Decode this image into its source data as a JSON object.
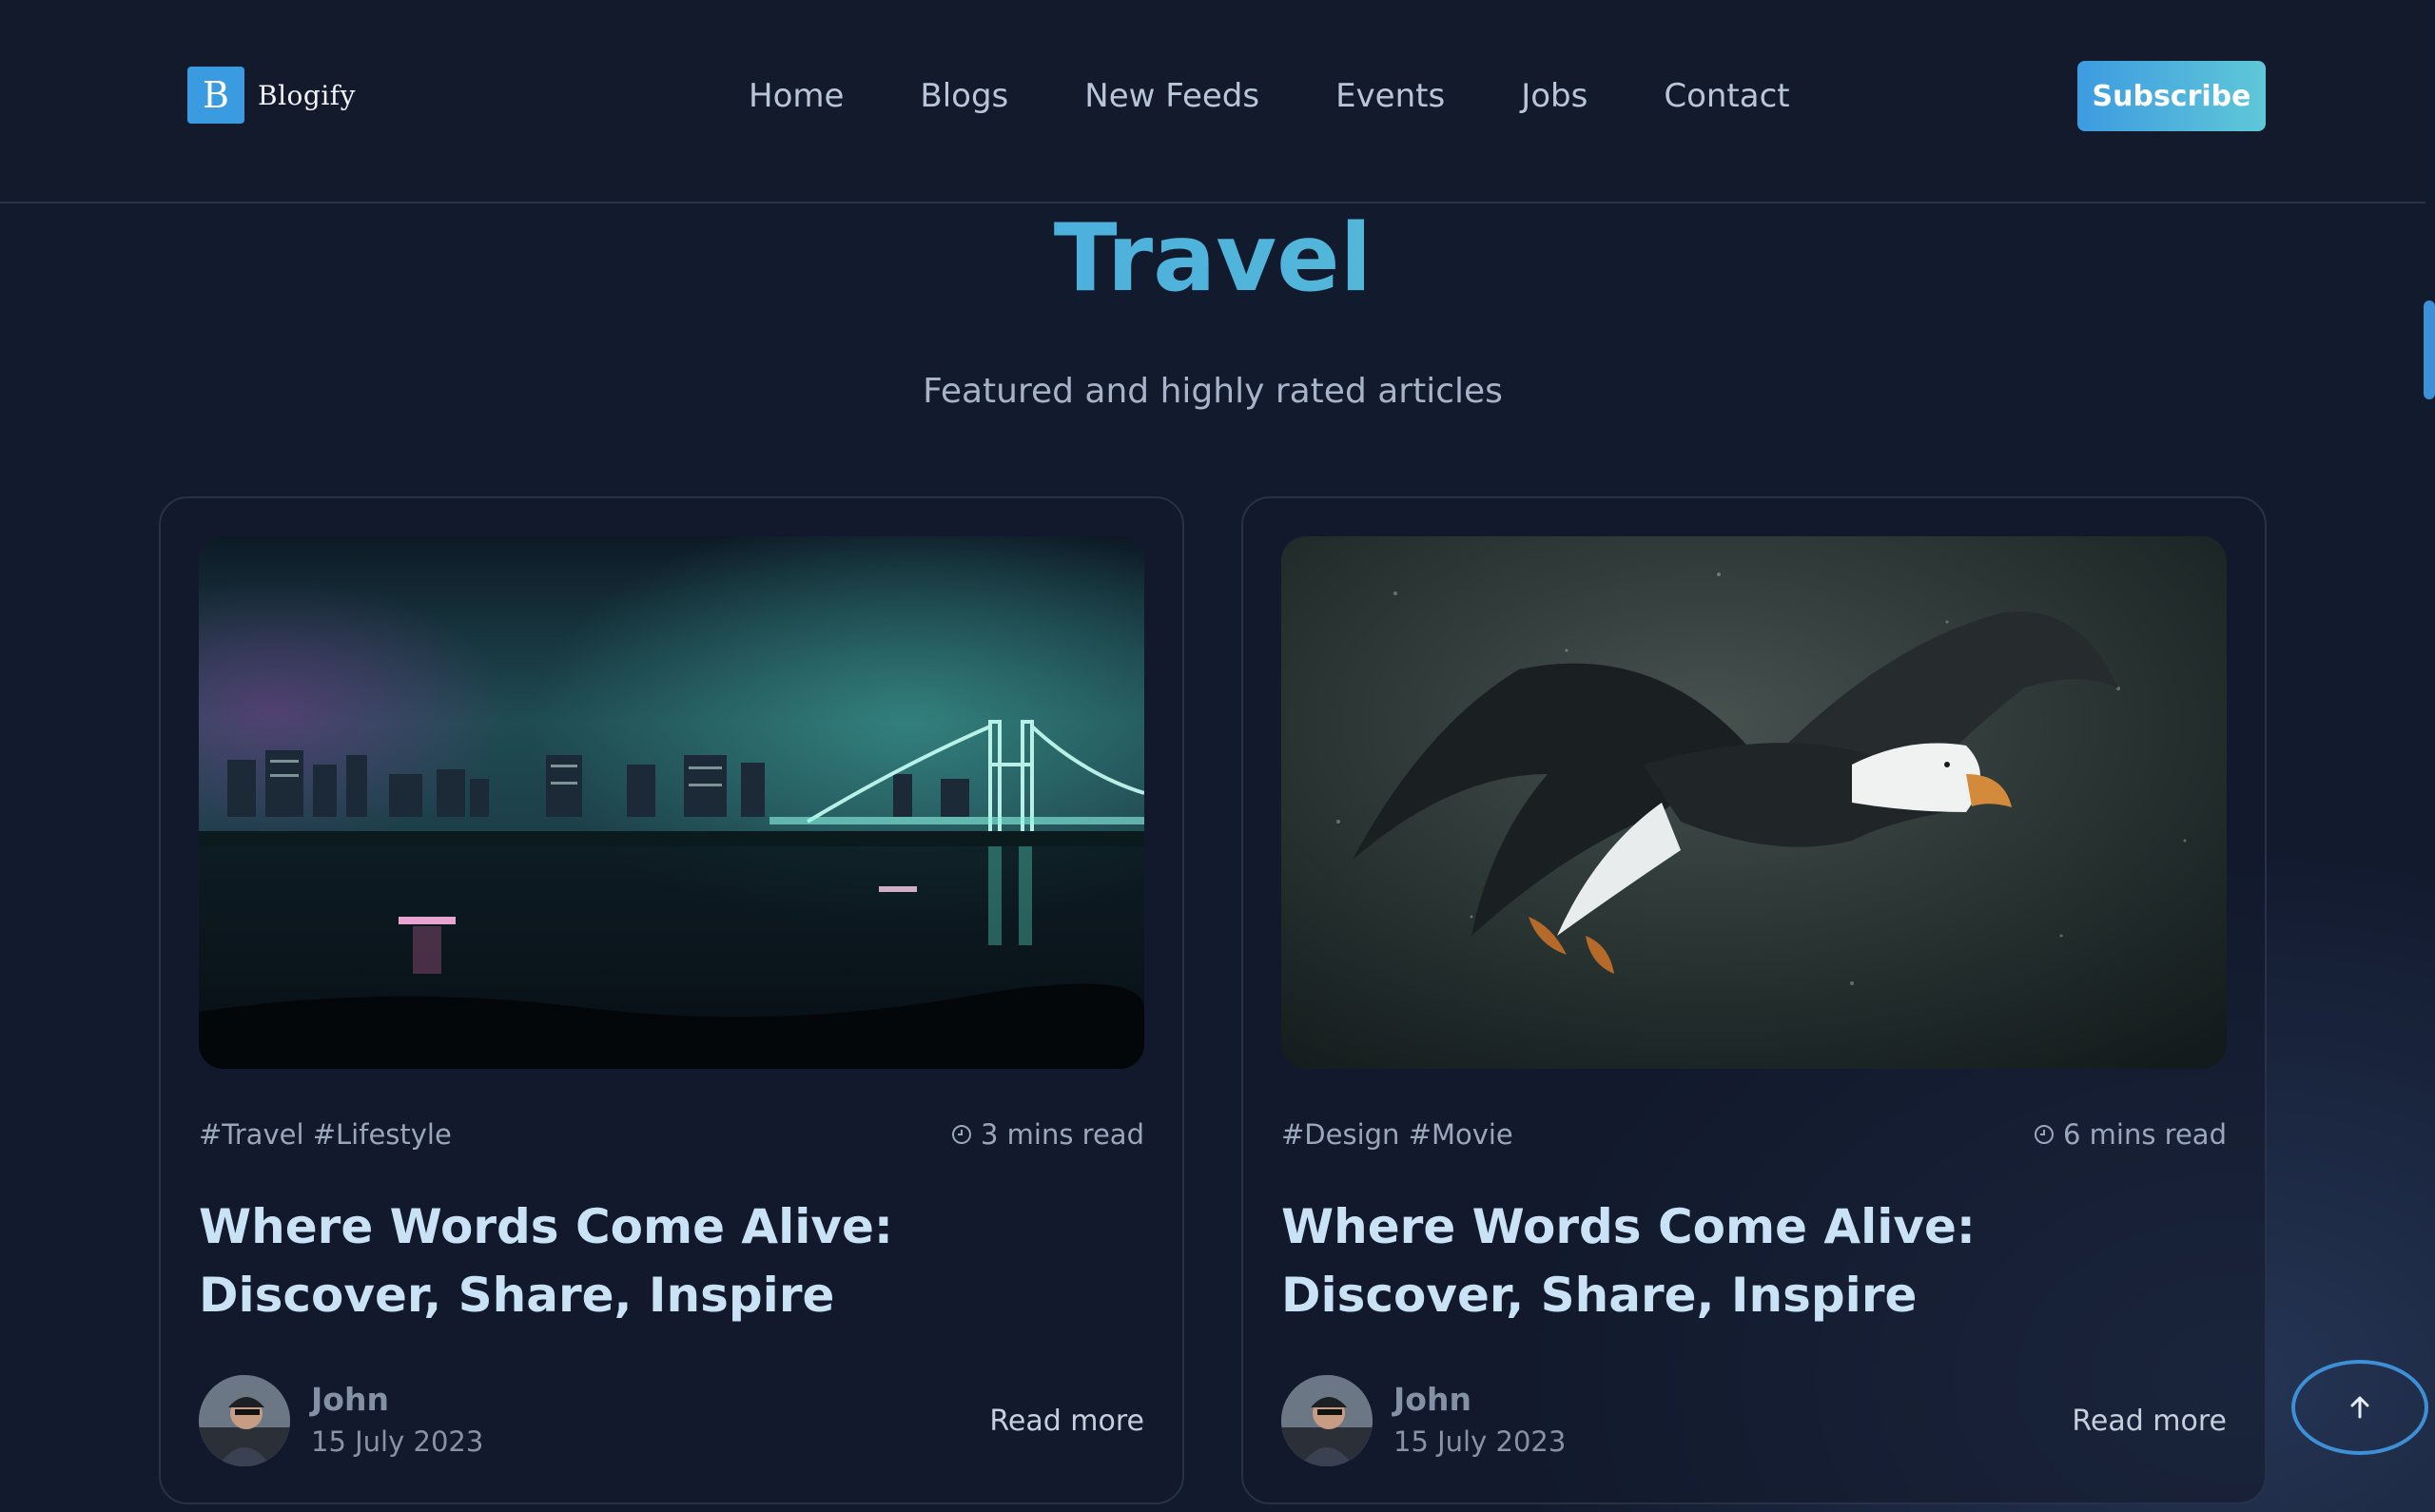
{
  "header": {
    "logo_letter": "B",
    "logo_text": "Blogify",
    "nav": [
      "Home",
      "Blogs",
      "New Feeds",
      "Events",
      "Jobs",
      "Contact"
    ],
    "subscribe_label": "Subscribe"
  },
  "hero": {
    "title": "Travel",
    "subtitle": "Featured and highly rated articles"
  },
  "cards": [
    {
      "tags": "#Travel #Lifestyle",
      "read_time": "3 mins read",
      "title": "Where Words Come Alive: Discover, Share, Inspire",
      "author": "John",
      "date": "15 July 2023",
      "read_more": "Read more",
      "image": "night-city-bridge"
    },
    {
      "tags": "#Design #Movie",
      "read_time": "6 mins read",
      "title": "Where Words Come Alive: Discover, Share, Inspire",
      "author": "John",
      "date": "15 July 2023",
      "read_more": "Read more",
      "image": "flying-eagle"
    }
  ],
  "colors": {
    "background": "#121a2e",
    "accent": "#3d9be0",
    "accent_end": "#66cfd6"
  }
}
